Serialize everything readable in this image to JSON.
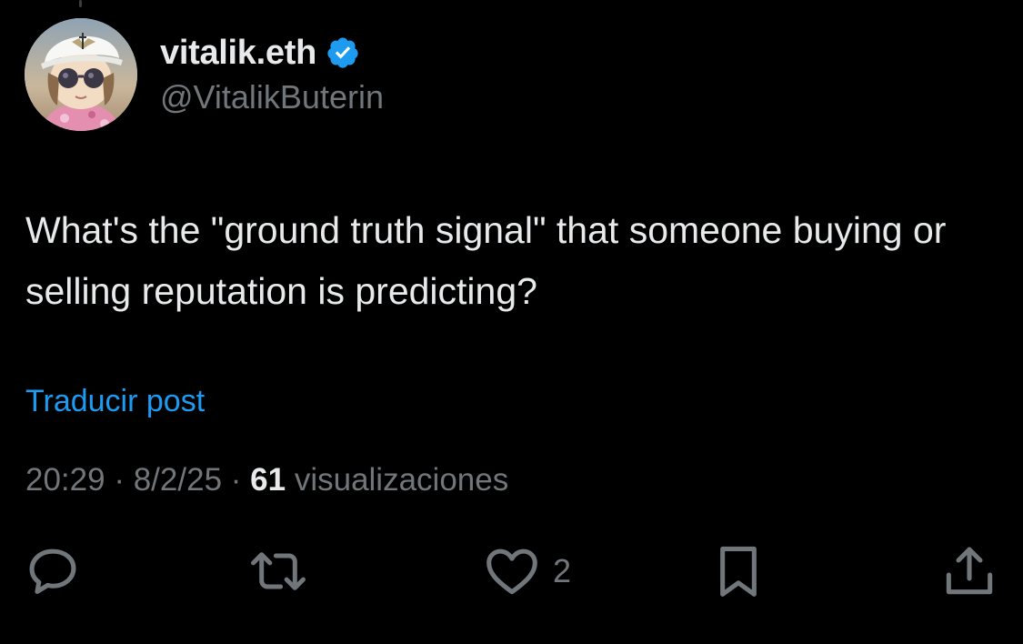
{
  "author": {
    "display_name": "vitalik.eth",
    "handle": "@VitalikButerin",
    "verified": true,
    "verified_color": "#1d9bf0"
  },
  "post": {
    "text": "What's the \"ground truth signal\" that someone buying or selling reputation is predicting?",
    "translate_label": "Traducir post"
  },
  "meta": {
    "time": "20:29",
    "separator": "·",
    "date": "8/2/25",
    "views_count": "61",
    "views_label": "visualizaciones"
  },
  "actions": {
    "reply_icon": "reply-icon",
    "repost_icon": "repost-icon",
    "like_icon": "heart-icon",
    "like_count": "2",
    "bookmark_icon": "bookmark-icon",
    "share_icon": "share-icon"
  },
  "colors": {
    "background": "#000000",
    "primary_text": "#e7e9ea",
    "secondary_text": "#71767b",
    "link": "#1d9bf0"
  }
}
